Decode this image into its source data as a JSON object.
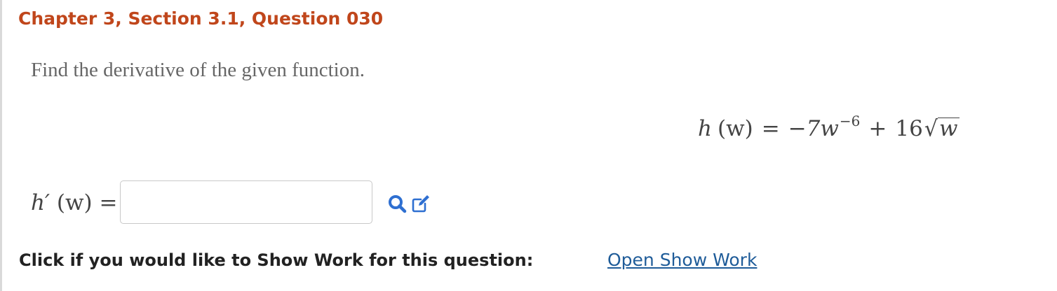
{
  "question": {
    "title": "Chapter 3, Section 3.1, Question 030",
    "prompt": "Find the derivative of the given function.",
    "given_function": {
      "lhs_name": "h",
      "variable": "(w)",
      "equals": "=",
      "term1": "−7w",
      "exponent": "−6",
      "plus": "+",
      "coefficient": "16",
      "radicand": "w"
    }
  },
  "answer": {
    "label_name": "h′",
    "label_variable": "(w)",
    "label_equals": "=",
    "input_value": "",
    "input_placeholder": ""
  },
  "icons": {
    "search": "search-icon",
    "edit": "edit-icon",
    "accent": "#2e6fd1"
  },
  "show_work": {
    "label": "Click if you would like to Show Work for this question:",
    "link": "Open Show Work"
  },
  "colors": {
    "title": "#c0461b",
    "link": "#1f5c99",
    "prompt": "#666666"
  }
}
